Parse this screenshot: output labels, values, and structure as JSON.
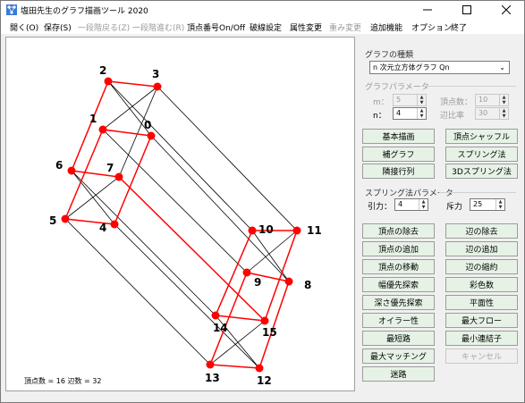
{
  "window": {
    "title": "塩田先生のグラフ描画ツール 2020"
  },
  "menu": [
    "開く(O)",
    "保存(S)",
    "一段階戻る(Z)",
    "一段階進む(R)",
    "頂点番号On/Off",
    "破線設定",
    "属性変更",
    "重み変更",
    "追加機能",
    "オプション",
    "終了"
  ],
  "graph": {
    "vertices": [
      "0",
      "1",
      "2",
      "3",
      "4",
      "5",
      "6",
      "7",
      "8",
      "9",
      "10",
      "11",
      "12",
      "13",
      "14",
      "15"
    ],
    "stats": "頂点数 = 16   辺数 = 32"
  },
  "graph_type": {
    "label": "グラフの種類",
    "value": "n 次元立方体グラフ Qn"
  },
  "graph_params": {
    "label": "グラフパラメータ",
    "m_label": "m：",
    "m_value": "5",
    "n_label": "n：",
    "n_value": "4",
    "vertex_count_label": "頂点数：",
    "vertex_count_value": "10",
    "edge_ratio_label": "辺比率",
    "edge_ratio_value": "30"
  },
  "buttons_top": [
    "基本描画",
    "頂点シャッフル",
    "補グラフ",
    "スプリング法",
    "隣接行列",
    "3Dスプリング法"
  ],
  "spring_params": {
    "label": "スプリング法パラメータ",
    "attract_label": "引力：",
    "attract_value": "4",
    "repel_label": "斥力",
    "repel_value": "25"
  },
  "buttons_bottom": [
    "頂点の除去",
    "辺の除去",
    "頂点の追加",
    "辺の追加",
    "頂点の移動",
    "辺の縮約",
    "幅優先探索",
    "彩色数",
    "深さ優先探索",
    "平面性",
    "オイラー性",
    "最大フロー",
    "最短路",
    "最小連結子",
    "最大マッチング",
    "キャンセル",
    "迷路"
  ],
  "colors": {
    "highlight": "#ff0000",
    "vertex": "#ff0000",
    "edge": "#000000",
    "button_bg": "#e6f2e6"
  }
}
